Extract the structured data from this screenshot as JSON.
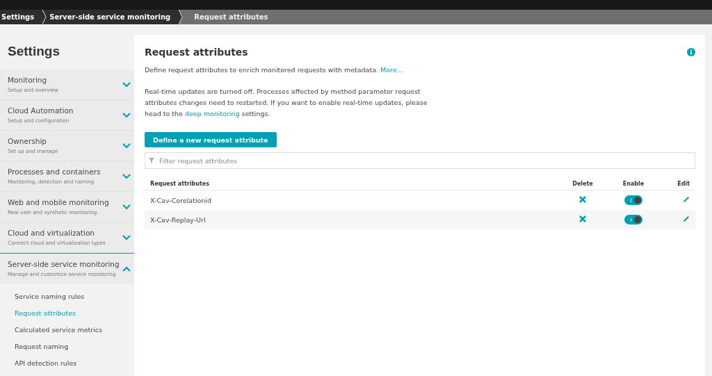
{
  "breadcrumb": [
    {
      "label": "Settings",
      "current": false
    },
    {
      "label": "Server-side service monitoring",
      "current": false
    },
    {
      "label": "Request attributes",
      "current": true
    }
  ],
  "sidebar": {
    "title": "Settings",
    "sections": [
      {
        "label": "Monitoring",
        "subtitle": "Setup and overview",
        "expanded": false
      },
      {
        "label": "Cloud Automation",
        "subtitle": "Setup and configuration",
        "expanded": false
      },
      {
        "label": "Ownership",
        "subtitle": "Set up and manage",
        "expanded": false
      },
      {
        "label": "Processes and containers",
        "subtitle": "Monitoring, detection and naming",
        "expanded": false
      },
      {
        "label": "Web and mobile monitoring",
        "subtitle": "Real user and synthetic monitoring",
        "expanded": false
      },
      {
        "label": "Cloud and virtualization",
        "subtitle": "Connect cloud and virtualization types",
        "expanded": false
      },
      {
        "label": "Server-side service monitoring",
        "subtitle": "Manage and customize service monitoring",
        "expanded": true,
        "children": [
          {
            "label": "Service naming rules",
            "selected": false
          },
          {
            "label": "Request attributes",
            "selected": true
          },
          {
            "label": "Calculated service metrics",
            "selected": false
          },
          {
            "label": "Request naming",
            "selected": false
          },
          {
            "label": "API detection rules",
            "selected": false
          }
        ]
      }
    ]
  },
  "main": {
    "title": "Request attributes",
    "description": "Define request attributes to enrich monitored requests with metadata.",
    "description_link": "More...",
    "notice": "Real-time updates are turned off. Processes affected by method parameter request attributes changes need to restarted. If you want to enable real-time updates, please head to the",
    "notice_link": "deep monitoring",
    "notice_end": "settings.",
    "button": "Define a new request attribute",
    "filter": {
      "placeholder": "Filter request attributes"
    },
    "table": {
      "columns": [
        "Request attributes",
        "Delete",
        "Enable",
        "Edit"
      ],
      "rows": [
        {
          "name": "X-Cav-Corelationid",
          "enabled": true
        },
        {
          "name": "X-Cav-Replay-Url",
          "enabled": true
        }
      ]
    }
  }
}
